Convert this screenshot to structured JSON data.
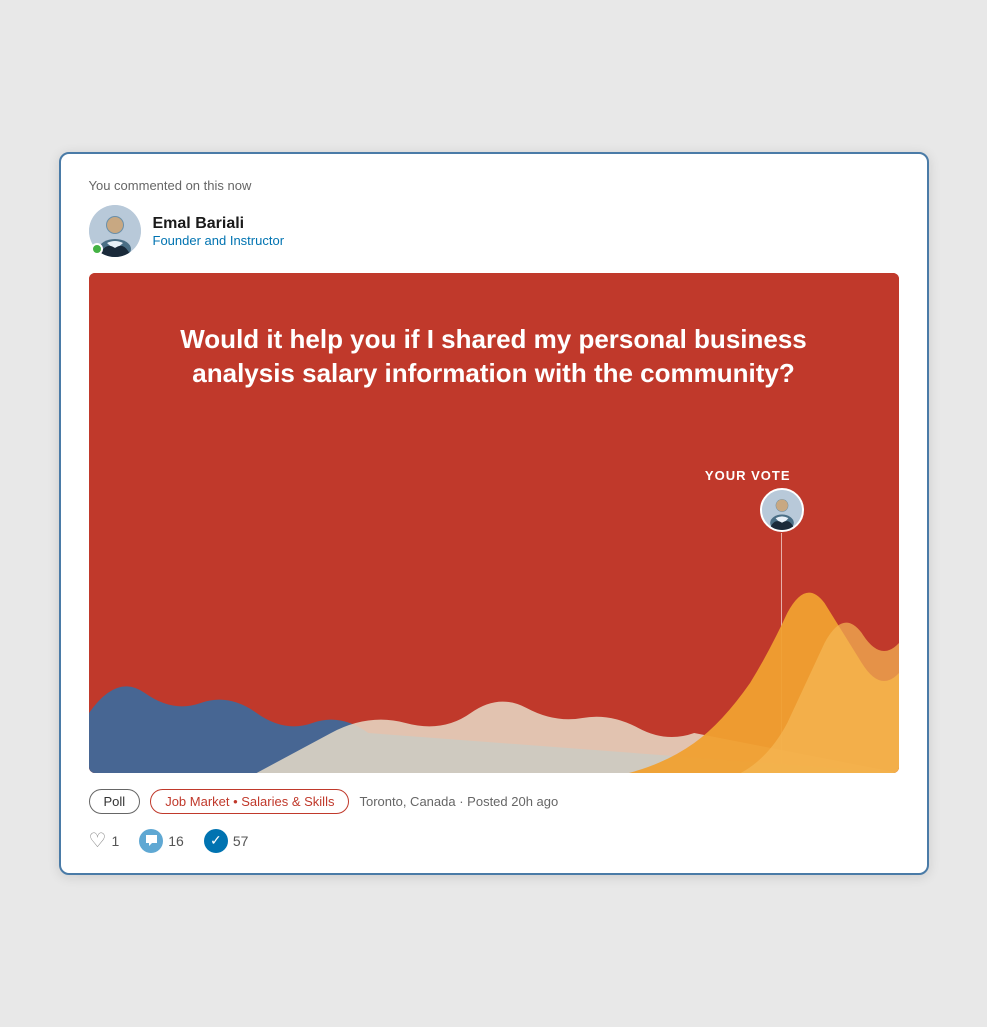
{
  "notice": {
    "text": "You commented on this now"
  },
  "author": {
    "name": "Emal Bariali",
    "title": "Founder and Instructor",
    "online": true
  },
  "poll": {
    "question": "Would it help you if I shared my personal business analysis salary information with the community?",
    "your_vote_label": "YOUR VOTE"
  },
  "tags": [
    {
      "label": "Poll",
      "highlight": false
    },
    {
      "label": "Job Market • Salaries & Skills",
      "highlight": true
    }
  ],
  "meta": {
    "location": "Toronto, Canada",
    "posted": "Posted 20h ago",
    "separator": "·"
  },
  "reactions": {
    "likes": {
      "count": "1",
      "icon": "heart"
    },
    "comments": {
      "count": "16",
      "icon": "comment"
    },
    "votes": {
      "count": "57",
      "icon": "check"
    }
  }
}
